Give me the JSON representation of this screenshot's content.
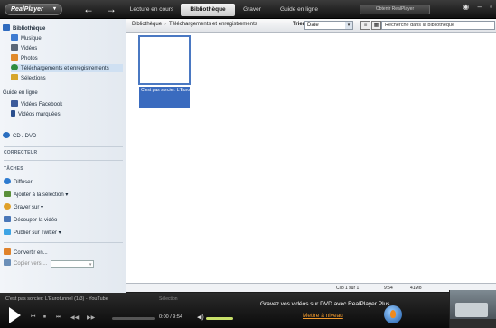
{
  "titlebar": {
    "logo": "RealPlayer",
    "logo_arrow": "▾",
    "back": "←",
    "forward": "→",
    "tabs": [
      {
        "label": "Lecture en cours"
      },
      {
        "label": "Bibliothèque",
        "active": true
      },
      {
        "label": "Graver"
      },
      {
        "label": "Guide en ligne"
      }
    ],
    "offer": "Obtenir RealPlayer",
    "window_icons": [
      "◉",
      "–",
      "▫"
    ]
  },
  "sidebar": {
    "library": "Bibliothèque",
    "library_items": [
      "Musique",
      "Vidéos",
      "Photos",
      "Téléchargements et enregistrements",
      "Sélections"
    ],
    "online_guide": "Guide en ligne",
    "online_items": [
      "Vidéos Facebook",
      "Vidéos marquées"
    ],
    "cd_dvd": "CD / DVD",
    "correcteur": "CORRECTEUR",
    "taches": "TÂCHES",
    "tasks": [
      "Diffuser",
      "Ajouter à la sélection ▾",
      "Graver sur ▾",
      "Découper la vidéo",
      "Publier sur Twitter ▾"
    ],
    "convert": "Convertir en...",
    "copy": "Copier vers ...",
    "copy_arrow": "▾"
  },
  "toolbar": {
    "crumb_1": "Bibliothèque",
    "crumb_sep": "›",
    "crumb_2": "Téléchargements et enregistrements",
    "sort_label": "Trier par",
    "sort_value": "Date",
    "sort_arrow": "▾",
    "search_placeholder": "Recherche dans la bibliothèque"
  },
  "content": {
    "item_caption": "C'est pas sorcier: L'Eurotunne..."
  },
  "status": {
    "clip": "Clip 1 sur 1",
    "duration": "9:54",
    "size": "41Mo"
  },
  "player": {
    "now_playing": "C'est pas sorcier: L'Eurotunnel (1/3) - YouTube",
    "ctrl_labels": "Sélection",
    "time": "0:00 / 9:54",
    "promo": "Gravez vos vidéos sur DVD avec RealPlayer Plus",
    "promo_link": "Mettre à niveau",
    "vol_icon": "◀)",
    "buttons": [
      "⏮",
      "⏹",
      "⏭",
      "◀◀",
      "▶▶"
    ]
  }
}
